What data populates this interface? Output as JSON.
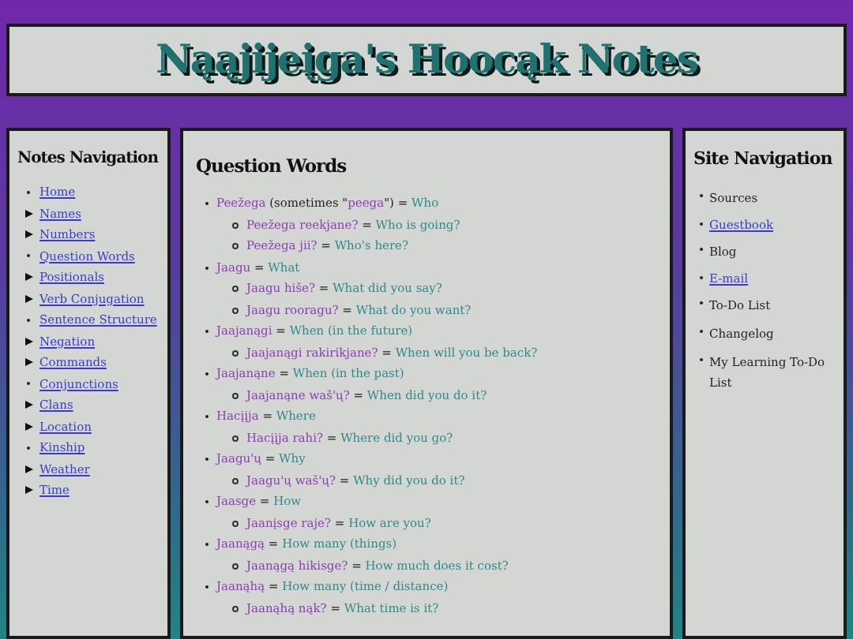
{
  "header": {
    "title": "Nąąjijeįga's Hoocąk Notes"
  },
  "notes_navigation": {
    "title": "Notes Navigation",
    "items": [
      {
        "label": "Home",
        "kind": "page"
      },
      {
        "label": "Names",
        "kind": "section"
      },
      {
        "label": "Numbers",
        "kind": "section"
      },
      {
        "label": "Question Words",
        "kind": "page"
      },
      {
        "label": "Positionals",
        "kind": "section"
      },
      {
        "label": "Verb Conjugation",
        "kind": "section"
      },
      {
        "label": "Sentence Structure",
        "kind": "page"
      },
      {
        "label": "Negation",
        "kind": "section"
      },
      {
        "label": "Commands",
        "kind": "section"
      },
      {
        "label": "Conjunctions",
        "kind": "page"
      },
      {
        "label": "Clans",
        "kind": "section"
      },
      {
        "label": "Location",
        "kind": "section"
      },
      {
        "label": "Kinship",
        "kind": "page"
      },
      {
        "label": "Weather",
        "kind": "section"
      },
      {
        "label": "Time",
        "kind": "section"
      }
    ]
  },
  "main": {
    "title": "Question Words",
    "entries": [
      {
        "term": "Peežega",
        "aside": {
          "before": "(sometimes \"",
          "term": "peega",
          "after": "\")"
        },
        "sign": "=",
        "meaning": "Who",
        "examples": [
          {
            "term": "Peežega reekjane?",
            "sign": "=",
            "meaning": "Who is going?"
          },
          {
            "term": "Peežega jii?",
            "sign": "=",
            "meaning": "Who's here?"
          }
        ]
      },
      {
        "term": "Jaagu",
        "sign": "=",
        "meaning": "What",
        "examples": [
          {
            "term": "Jaagu hiše?",
            "sign": "=",
            "meaning": "What did you say?"
          },
          {
            "term": "Jaagu rooragu?",
            "sign": "=",
            "meaning": "What do you want?"
          }
        ]
      },
      {
        "term": "Jaajanągi",
        "sign": "=",
        "meaning": "When (in the future)",
        "examples": [
          {
            "term": "Jaajanągi rakirikjane?",
            "sign": "=",
            "meaning": "When will you be back?"
          }
        ]
      },
      {
        "term": "Jaajanąne",
        "sign": "=",
        "meaning": "When (in the past)",
        "examples": [
          {
            "term": "Jaajanąne waš'ų?",
            "sign": "=",
            "meaning": "When did you do it?"
          }
        ]
      },
      {
        "term": "Hacįįja",
        "sign": "=",
        "meaning": "Where",
        "examples": [
          {
            "term": "Hacįįja rahi?",
            "sign": "=",
            "meaning": "Where did you go?"
          }
        ]
      },
      {
        "term": "Jaagu'ų",
        "sign": "=",
        "meaning": "Why",
        "examples": [
          {
            "term": "Jaagu'ų waš'ų?",
            "sign": "=",
            "meaning": "Why did you do it?"
          }
        ]
      },
      {
        "term": "Jaasge",
        "sign": "=",
        "meaning": "How",
        "examples": [
          {
            "term": "Jaanįsge raje?",
            "sign": "=",
            "meaning": "How are you?"
          }
        ]
      },
      {
        "term": "Jaanągą",
        "sign": "=",
        "meaning": "How many (things)",
        "examples": [
          {
            "term": "Jaanągą hikisge?",
            "sign": "=",
            "meaning": "How much does it cost?"
          }
        ]
      },
      {
        "term": "Jaanąhą",
        "sign": "=",
        "meaning": "How many (time / distance)",
        "examples": [
          {
            "term": "Jaanąhą nąk?",
            "sign": "=",
            "meaning": "What time is it?"
          }
        ]
      }
    ]
  },
  "site_navigation": {
    "title": "Site Navigation",
    "items": [
      {
        "label": "Sources",
        "kind": "text"
      },
      {
        "label": "Guestbook",
        "kind": "link"
      },
      {
        "label": "Blog",
        "kind": "text"
      },
      {
        "label": "E-mail",
        "kind": "link"
      },
      {
        "label": "To-Do List",
        "kind": "text"
      },
      {
        "label": "Changelog",
        "kind": "text"
      },
      {
        "label": "My Learning To-Do List",
        "kind": "text"
      }
    ]
  }
}
